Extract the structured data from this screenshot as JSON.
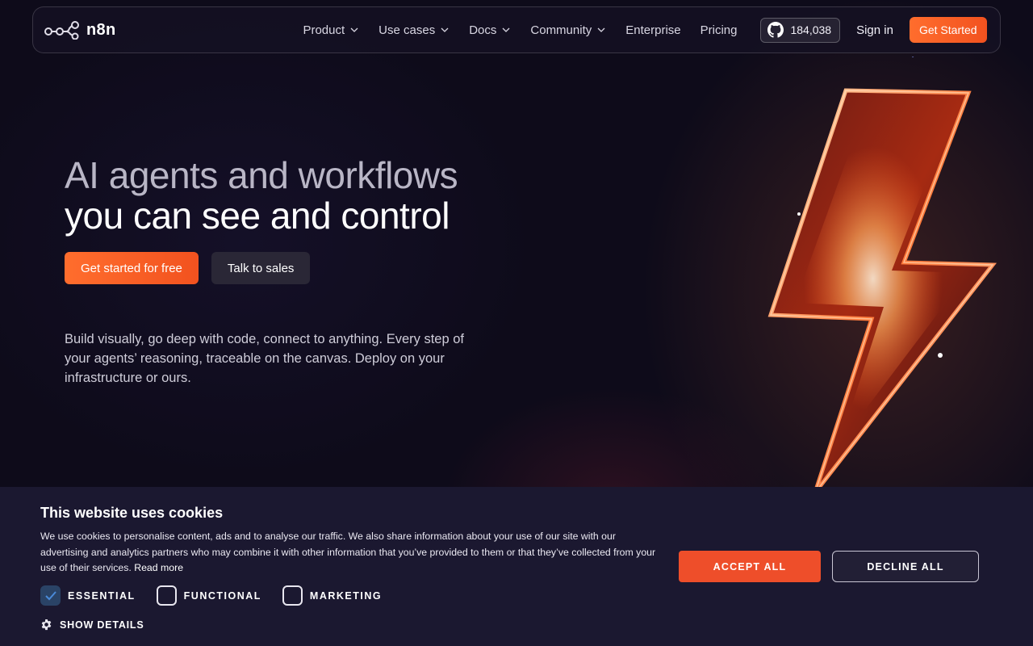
{
  "nav": {
    "logo_text": "n8n",
    "links": [
      {
        "label": "Product",
        "dropdown": true
      },
      {
        "label": "Use cases",
        "dropdown": true
      },
      {
        "label": "Docs",
        "dropdown": true
      },
      {
        "label": "Community",
        "dropdown": true
      },
      {
        "label": "Enterprise",
        "dropdown": false
      },
      {
        "label": "Pricing",
        "dropdown": false
      }
    ],
    "github_stars": "184,038",
    "sign_in": "Sign in",
    "get_started": "Get Started"
  },
  "hero": {
    "title_line1": "AI agents and workflows",
    "title_line2": "you can see and control",
    "cta_primary": "Get started for free",
    "cta_secondary": "Talk to sales",
    "description": "Build visually, go deep with code, connect to anything. Every step of your agents’ reasoning, traceable on the canvas. Deploy on your infrastructure or ours."
  },
  "cookie": {
    "title": "This website uses cookies",
    "text": "We use cookies to personalise content, ads and to analyse our traffic. We also share information about your use of our site with our advertising and analytics partners who may combine it with other information that you’ve provided to them or that they’ve collected from your use of their services.",
    "read_more": "Read more",
    "checkboxes": [
      {
        "label": "ESSENTIAL",
        "checked": true
      },
      {
        "label": "FUNCTIONAL",
        "checked": false
      },
      {
        "label": "MARKETING",
        "checked": false
      }
    ],
    "show_details": "SHOW DETAILS",
    "accept_all": "ACCEPT ALL",
    "decline_all": "DECLINE ALL"
  },
  "colors": {
    "accent": "#ff6d2d",
    "background": "#0e0b1a",
    "banner": "#1b1830"
  }
}
